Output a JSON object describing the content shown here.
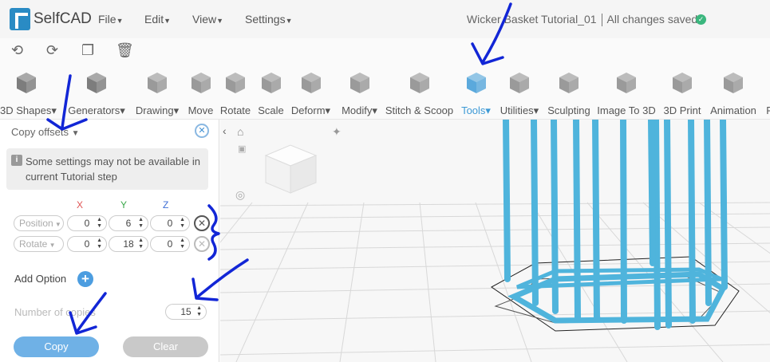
{
  "app": {
    "name": "SelfCAD"
  },
  "menu": [
    {
      "label": "File"
    },
    {
      "label": "Edit"
    },
    {
      "label": "View"
    },
    {
      "label": "Settings"
    }
  ],
  "document": {
    "title": "Wicker Basket Tutorial_01",
    "status": "All changes saved"
  },
  "quickbar": {
    "icons": [
      "undo-icon",
      "redo-icon",
      "copy-icon",
      "delete-icon"
    ]
  },
  "toolbar": {
    "tools": [
      {
        "label": "3D Shapes",
        "dropdown": true,
        "icon": "cube-icon"
      },
      {
        "label": "Generators",
        "dropdown": true,
        "icon": "generator-icon"
      },
      {
        "label": "Drawing",
        "dropdown": true,
        "icon": "drawing-icon"
      },
      {
        "label": "Move",
        "dropdown": false,
        "icon": "move-icon"
      },
      {
        "label": "Rotate",
        "dropdown": false,
        "icon": "rotate-icon"
      },
      {
        "label": "Scale",
        "dropdown": false,
        "icon": "scale-icon"
      },
      {
        "label": "Deform",
        "dropdown": true,
        "icon": "deform-icon"
      },
      {
        "label": "Modify",
        "dropdown": true,
        "icon": "modify-icon"
      },
      {
        "label": "Stitch & Scoop",
        "dropdown": false,
        "icon": "stitch-scoop-icon"
      },
      {
        "label": "Tools",
        "dropdown": true,
        "icon": "tools-icon",
        "active": true
      },
      {
        "label": "Utilities",
        "dropdown": true,
        "icon": "utilities-icon"
      },
      {
        "label": "Sculpting",
        "dropdown": false,
        "icon": "sculpting-icon"
      },
      {
        "label": "Image To 3D",
        "dropdown": false,
        "icon": "image-to-3d-icon"
      },
      {
        "label": "3D Print",
        "dropdown": false,
        "icon": "3d-print-icon"
      },
      {
        "label": "Animation",
        "dropdown": false,
        "icon": "animation-icon"
      },
      {
        "label": "R",
        "dropdown": false,
        "icon": ""
      }
    ]
  },
  "panel": {
    "title": "Copy offsets",
    "notice": "Some settings may not be available in current Tutorial step",
    "axes": [
      "X",
      "Y",
      "Z"
    ],
    "rows": [
      {
        "mode": "Position",
        "x": "0",
        "y": "6",
        "z": "0"
      },
      {
        "mode": "Rotate",
        "x": "0",
        "y": "18",
        "z": "0"
      }
    ],
    "add_option": "Add Option",
    "copies_label": "Number of copies",
    "copies_value": "15",
    "copy_button": "Copy",
    "clear_button": "Clear"
  },
  "colors": {
    "accent": "#3e9ad6",
    "model": "#4fb4dc",
    "annotation": "#1226d6"
  }
}
